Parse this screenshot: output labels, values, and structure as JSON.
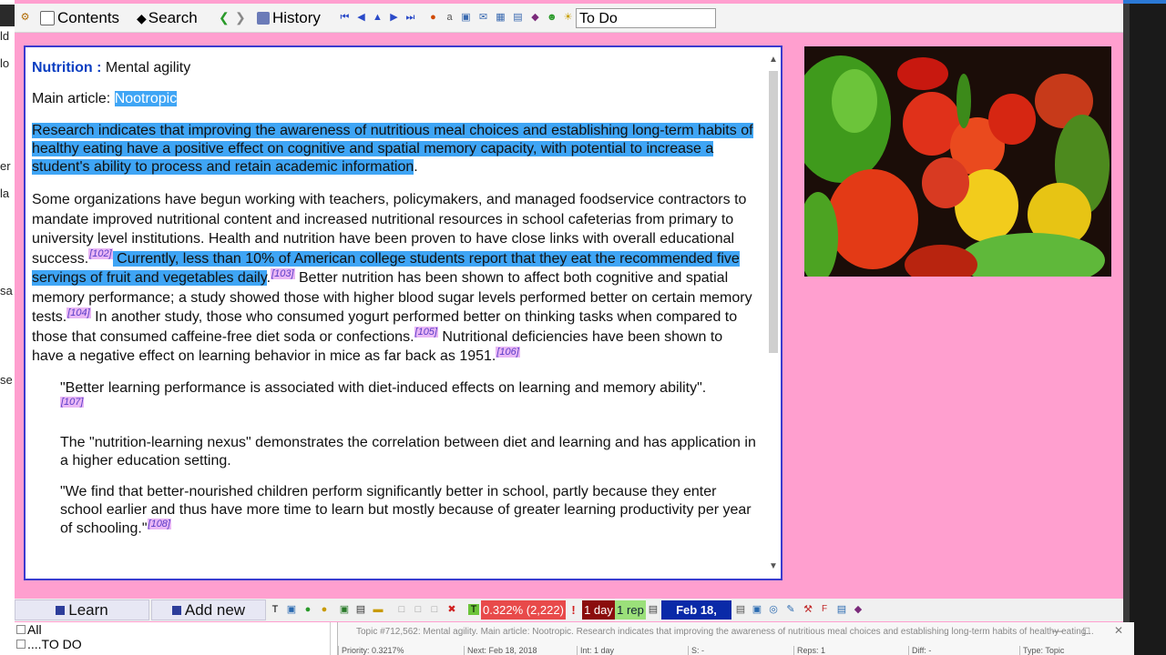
{
  "toolbar": {
    "contents_label": "Contents",
    "search_label": "Search",
    "history_label": "History",
    "category_value": "To Do"
  },
  "article": {
    "heading_title": "Nutrition :",
    "heading_sub": "Mental agility",
    "main_article_prefix": "Main article:",
    "main_article_link": "Nootropic",
    "p1": "Research indicates that improving the awareness of nutritious meal choices and establishing long-term habits of healthy eating have a positive effect on cognitive and spatial memory capacity, with potential to increase a student's ability to process and retain academic information",
    "p1_end": ".",
    "p2_a": "Some organizations have begun working with teachers, policymakers, and managed foodservice contractors to mandate improved nutritional content and increased nutritional resources in school cafeterias from primary to university level institutions. Health and nutrition have been proven to have close links with overall educational success.",
    "ref102": "[102]",
    "p2_b": " Currently, less than 10% of American college students report that they eat the recommended five servings of fruit and vegetables daily",
    "p2_c": ".",
    "ref103": "[103]",
    "p2_d": " Better nutrition has been shown to affect both cognitive and spatial memory performance; a study showed those with higher blood sugar levels performed better on certain memory tests.",
    "ref104": "[104]",
    "p2_e": " In another study, those who consumed yogurt performed better on thinking tasks when compared to those that consumed caffeine-free diet soda or confections.",
    "ref105": "[105]",
    "p2_f": " Nutritional deficiencies have been shown to have a negative effect on learning behavior in mice as far back as 1951.",
    "ref106": "[106]",
    "q1": "\"Better learning performance is associated with diet-induced effects on learning and memory ability\".",
    "ref107": "[107]",
    "q2": "The \"nutrition-learning nexus\" demonstrates the correlation between diet and learning and has application in a higher education setting.",
    "q3": "\"We find that better-nourished children perform significantly better in school, partly because they enter school earlier and thus have more time to learn but mostly because of greater learning productivity per year of schooling.\"",
    "ref108": "[108]"
  },
  "bottombar": {
    "learn_label": "Learn",
    "add_new_label": "Add new",
    "stat_percent": "0.322% (2,222)",
    "stat_excl": "!",
    "stat_interval": "1 day",
    "stat_reps": "1 rep",
    "stat_date": "Feb 18, 2018"
  },
  "tree": {
    "item_all": "All",
    "item_todo": "....TO DO"
  },
  "subwindow": {
    "title": "Topic #712,562: Mental agility. Main article: Nootropic. Research indicates that improving the awareness of nutritious meal choices and establishing long-term habits of healthy eating...",
    "priority": "Priority: 0.3217%",
    "next": "Next: Feb 18, 2018",
    "interval": "Int: 1 day",
    "s": "S: -",
    "reps": "Reps: 1",
    "diff": "Diff: -",
    "type": "Type: Topic"
  },
  "colors": {
    "window_bg": "#ff9fcf",
    "highlight": "#3fa5f5",
    "panel_border": "#3b3bcf",
    "title_blue": "#0b3fc2",
    "ref_bg": "#e9b6f5",
    "stat_red": "#e84a4a",
    "stat_dark_red": "#8b0d0d",
    "stat_green": "#9be07a",
    "stat_navy": "#0a2aa8"
  }
}
